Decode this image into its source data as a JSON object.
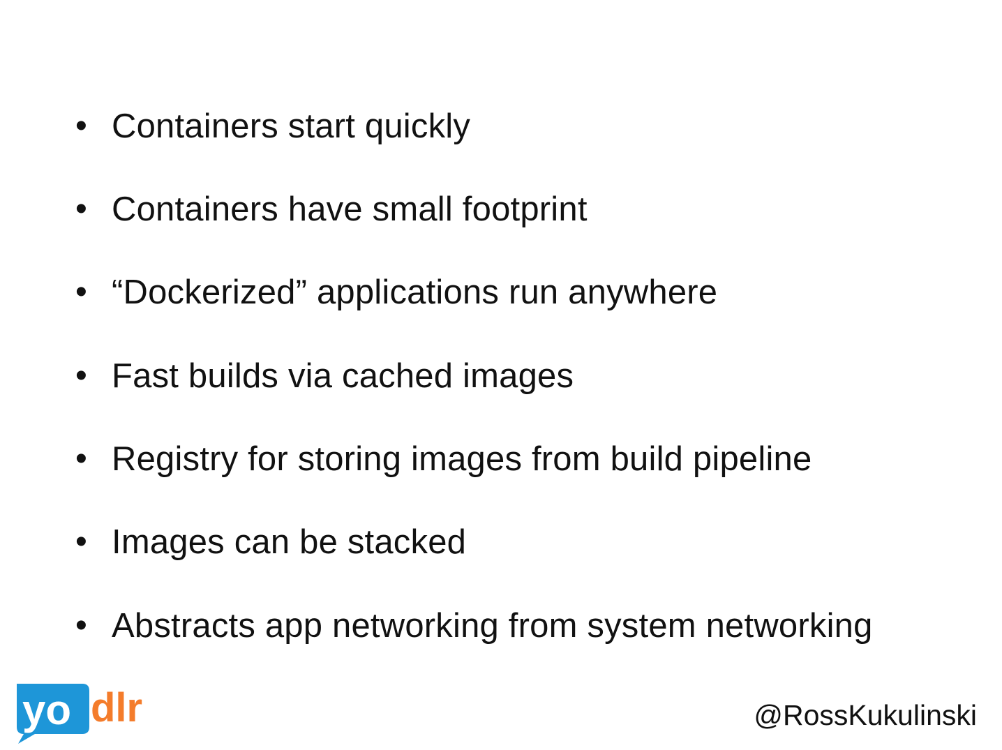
{
  "slide": {
    "bullets": [
      "Containers start quickly",
      "Containers have small footprint",
      "“Dockerized” applications run anywhere",
      "Fast builds via cached images",
      "Registry for storing images from build pipeline",
      "Images can be stacked",
      "Abstracts app networking from system networking"
    ],
    "bullet_glyph": "•",
    "footer": {
      "logo_text": "yodlr",
      "handle": "@RossKukulinski"
    },
    "colors": {
      "logo_blue": "#1e96d8",
      "logo_orange": "#f47c2b",
      "text": "#111111",
      "background": "#ffffff"
    }
  }
}
